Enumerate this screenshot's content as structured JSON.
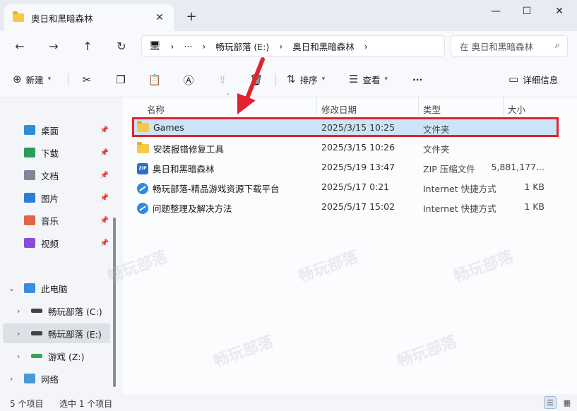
{
  "window": {
    "tab_title": "奥日和黑暗森林",
    "tab_close": "✕",
    "new_tab": "+",
    "minimize": "—",
    "maximize": "☐",
    "close": "✕"
  },
  "nav": {
    "back": "←",
    "forward": "→",
    "up": "↑",
    "refresh": "↻",
    "breadcrumb": [
      "畅玩部落 (E:)",
      "奥日和黑暗森林"
    ],
    "more": "···",
    "separator": "›",
    "search_placeholder": "在 奥日和黑暗森林"
  },
  "toolbar": {
    "new_label": "新建",
    "sort_label": "排序",
    "view_label": "查看",
    "more": "···",
    "details_label": "详细信息"
  },
  "sidebar": {
    "quick": [
      {
        "label": "桌面",
        "icon": "desktop-icon",
        "color": "#2e8fd8"
      },
      {
        "label": "下载",
        "icon": "download-icon",
        "color": "#2a9d5c"
      },
      {
        "label": "文档",
        "icon": "document-icon",
        "color": "#7d8796"
      },
      {
        "label": "图片",
        "icon": "pictures-icon",
        "color": "#2b7fd3"
      },
      {
        "label": "音乐",
        "icon": "music-icon",
        "color": "#e0644a"
      },
      {
        "label": "视频",
        "icon": "video-icon",
        "color": "#8a4bd6"
      }
    ],
    "this_pc": "此电脑",
    "drives": [
      {
        "label": "畅玩部落 (C:)",
        "icon": "drive-c-icon"
      },
      {
        "label": "畅玩部落 (E:)",
        "icon": "drive-e-icon"
      },
      {
        "label": "游戏 (Z:)",
        "icon": "drive-z-icon"
      }
    ],
    "network": "网络"
  },
  "columns": {
    "name": "名称",
    "modified": "修改日期",
    "type": "类型",
    "size": "大小"
  },
  "files": [
    {
      "name": "Games",
      "modified": "2025/3/15 10:25",
      "type": "文件夹",
      "size": "",
      "icon": "folder-icon"
    },
    {
      "name": "安装报错修复工具",
      "modified": "2025/3/15 10:26",
      "type": "文件夹",
      "size": "",
      "icon": "folder-icon"
    },
    {
      "name": "奥日和黑暗森林",
      "modified": "2025/5/19 13:47",
      "type": "ZIP 压缩文件",
      "size": "5,881,177...",
      "icon": "zip-icon"
    },
    {
      "name": "畅玩部落-精品游戏资源下载平台",
      "modified": "2025/5/17 0:21",
      "type": "Internet 快捷方式",
      "size": "1 KB",
      "icon": "url-icon"
    },
    {
      "name": "问题整理及解决方法",
      "modified": "2025/5/17 15:02",
      "type": "Internet 快捷方式",
      "size": "1 KB",
      "icon": "url-icon"
    }
  ],
  "zip_badge": "ZIP",
  "status": {
    "count": "5 个项目",
    "selected": "选中 1 个项目"
  },
  "colors": {
    "highlight_box": "#e0242f",
    "arrow": "#e0242f",
    "selection": "#cce4f7"
  }
}
